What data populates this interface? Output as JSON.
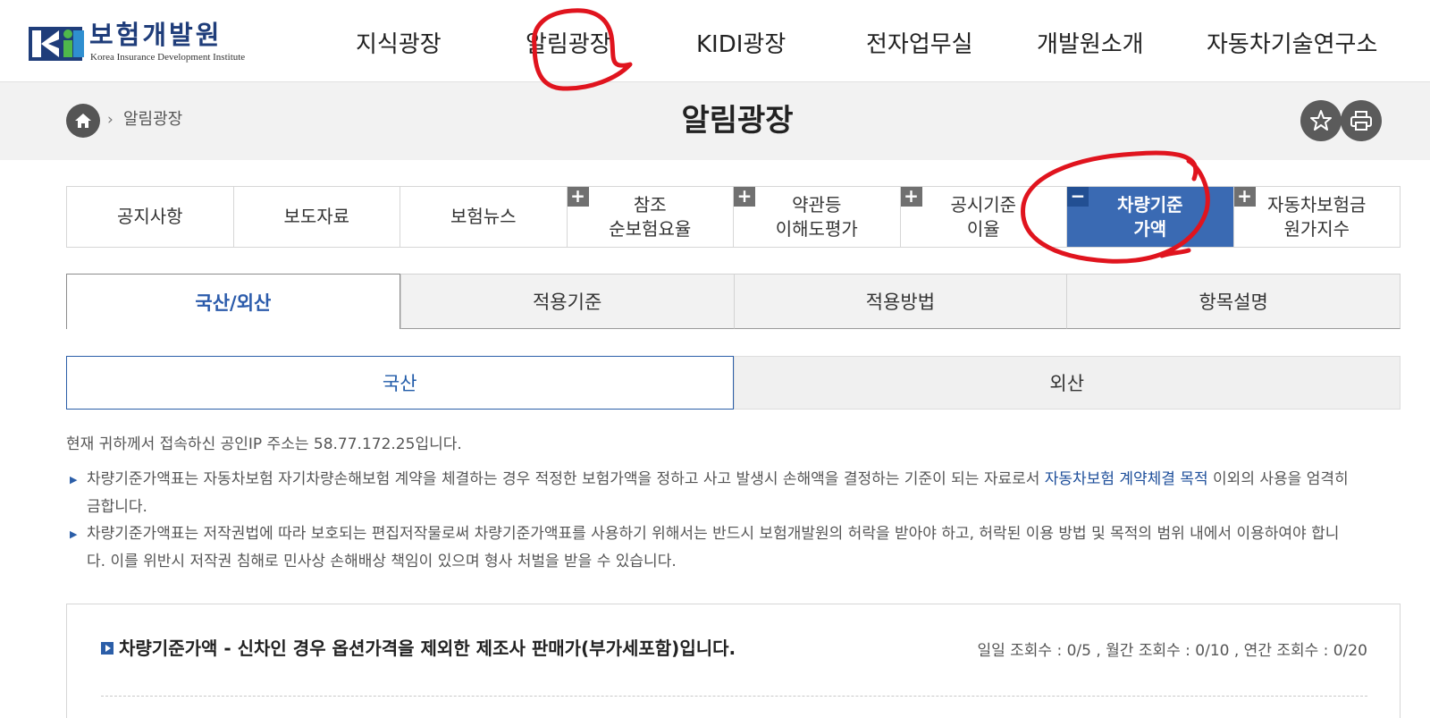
{
  "header": {
    "logo_ko": "보험개발원",
    "logo_en": "Korea Insurance Development Institute",
    "nav": [
      {
        "label": "지식광장"
      },
      {
        "label": "알림광장"
      },
      {
        "label": "KIDI광장"
      },
      {
        "label": "전자업무실"
      },
      {
        "label": "개발원소개"
      },
      {
        "label": "자동차기술연구소"
      }
    ]
  },
  "subbar": {
    "breadcrumb_sep": "›",
    "breadcrumb_label": "알림광장",
    "page_title": "알림광장",
    "icons": [
      "home-icon",
      "star-icon",
      "print-icon"
    ]
  },
  "lnb": {
    "tabs": [
      {
        "label": "공지사항"
      },
      {
        "label": "보도자료"
      },
      {
        "label": "보험뉴스"
      },
      {
        "label": "참조\n순보험요율",
        "toggle": "+"
      },
      {
        "label": "약관등\n이해도평가",
        "toggle": "+"
      },
      {
        "label": "공시기준\n이율",
        "toggle": "+"
      },
      {
        "label": "차량기준\n가액",
        "toggle": "−",
        "active": true
      },
      {
        "label": "자동차보험금\n원가지수",
        "toggle": "+"
      }
    ]
  },
  "subtabs": [
    {
      "label": "국산/외산",
      "active": true
    },
    {
      "label": "적용기준"
    },
    {
      "label": "적용방법"
    },
    {
      "label": "항목설명"
    }
  ],
  "segment": [
    {
      "label": "국산",
      "active": true
    },
    {
      "label": "외산"
    }
  ],
  "info": {
    "ip_line": "현재 귀하께서 접속하신 공인IP 주소는 58.77.172.25입니다.",
    "notice1_a": "차량기준가액표는 자동차보험 자기차량손해보험 계약을 체결하는 경우 적정한 보험가액을 정하고 사고 발생시 손해액을 결정하는 기준이 되는 자료로서 ",
    "notice1_hl": "자동차보험 계약체결 목적",
    "notice1_b": " 이외의 사용을 엄격히",
    "notice1_c": "금합니다.",
    "notice2_a": "차량기준가액표는 저작권법에 따라 보호되는 편집저작물로써 차량기준가액표를 사용하기 위해서는 반드시 보험개발원의 허락을 받아야 하고, 허락된 이용 방법 및 목적의 범위 내에서 이용하여야 합니",
    "notice2_b": "다. 이를 위반시 저작권 침해로 민사상 손해배상 책임이 있으며 형사 처벌을 받을 수 있습니다."
  },
  "result": {
    "title": "차량기준가액 - 신차인 경우 옵션가격을 제외한 제조사 판매가(부가세포함)입니다.",
    "count": "일일 조회수 : 0/5 , 월간 조회수 : 0/10 , 연간 조회수 : 0/20"
  },
  "colors": {
    "brand_blue": "#3a6ab3",
    "accent_text": "#1d4e9a",
    "annotation_red": "#e0141e"
  }
}
